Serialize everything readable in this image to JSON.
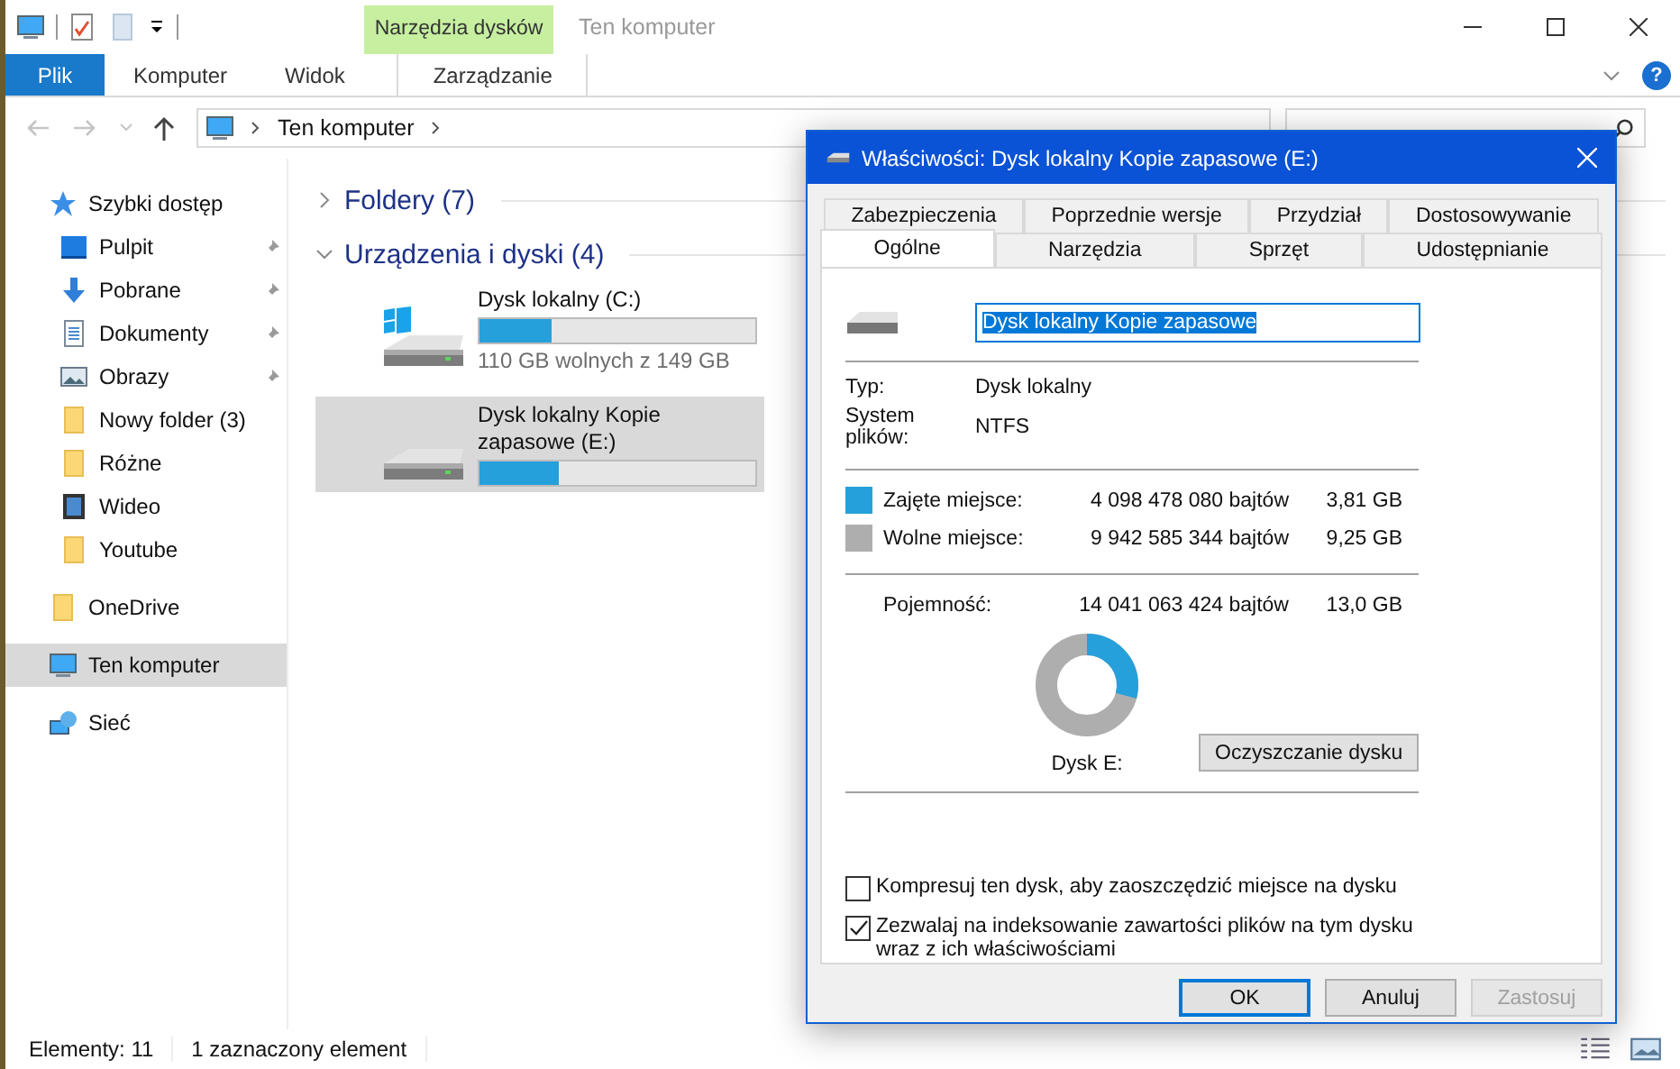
{
  "ribbon": {
    "context_group": "Narzędzia dysków",
    "window_title": "Ten komputer",
    "help": "?",
    "tabs": [
      {
        "label": "Plik",
        "kind": "file"
      },
      {
        "label": "Komputer",
        "kind": "normal"
      },
      {
        "label": "Widok",
        "kind": "normal"
      },
      {
        "label": "Zarządzanie",
        "kind": "context"
      }
    ]
  },
  "address": {
    "path": [
      "Ten komputer"
    ]
  },
  "sidebar": {
    "items": [
      {
        "label": "Szybki dostęp",
        "kind": "star",
        "selected": false,
        "children": [
          {
            "label": "Pulpit",
            "kind": "desktop",
            "pinned": true,
            "selected": false
          },
          {
            "label": "Pobrane",
            "kind": "download",
            "pinned": true,
            "selected": false
          },
          {
            "label": "Dokumenty",
            "kind": "documents",
            "pinned": true,
            "selected": false
          },
          {
            "label": "Obrazy",
            "kind": "pictures",
            "pinned": true,
            "selected": false
          },
          {
            "label": "Nowy folder (3)",
            "kind": "folder",
            "pinned": false,
            "selected": false
          },
          {
            "label": "Różne",
            "kind": "folder",
            "pinned": false,
            "selected": false
          },
          {
            "label": "Wideo",
            "kind": "video",
            "pinned": false,
            "selected": false
          },
          {
            "label": "Youtube",
            "kind": "folder",
            "pinned": false,
            "selected": false
          }
        ]
      },
      {
        "label": "OneDrive",
        "kind": "folder",
        "selected": false
      },
      {
        "label": "Ten komputer",
        "kind": "computer",
        "selected": true
      },
      {
        "label": "Sieć",
        "kind": "network",
        "selected": false
      }
    ]
  },
  "groups": [
    {
      "label": "Foldery (7)",
      "expanded": false
    },
    {
      "label": "Urządzenia i dyski (4)",
      "expanded": true,
      "drives": [
        {
          "name": "Dysk lokalny (C:)",
          "free": "110 GB wolnych z 149 GB",
          "level": 0.26,
          "system": true,
          "selected": false
        },
        {
          "name": "Dysk lokalny Kopie zapasowe (E:)",
          "level": 0.29,
          "system": false,
          "selected": true
        }
      ]
    }
  ],
  "status_bar": {
    "items": "Elementy: 11",
    "selection": "1 zaznaczony element"
  },
  "dialog": {
    "title": "Właściwości: Dysk lokalny Kopie zapasowe (E:)",
    "tab_rows": [
      [
        {
          "label": "Zabezpieczenia",
          "selected": false
        },
        {
          "label": "Poprzednie wersje",
          "selected": false
        },
        {
          "label": "Przydział",
          "selected": false
        },
        {
          "label": "Dostosowywanie",
          "selected": false
        }
      ],
      [
        {
          "label": "Ogólne",
          "selected": true
        },
        {
          "label": "Narzędzia",
          "selected": false
        },
        {
          "label": "Sprzęt",
          "selected": false
        },
        {
          "label": "Udostępnianie",
          "selected": false
        }
      ]
    ],
    "name_field": {
      "value": "Dysk lokalny Kopie zapasowe"
    },
    "info": [
      {
        "label": "Typ:",
        "value": "Dysk lokalny"
      },
      {
        "label": "System plików:",
        "value": "NTFS"
      }
    ],
    "usage": [
      {
        "label": "Zajęte miejsce:",
        "bytes": "4 098 478 080 bajtów",
        "size": "3,81 GB",
        "color": "#26a0da"
      },
      {
        "label": "Wolne miejsce:",
        "bytes": "9 942 585 344 bajtów",
        "size": "9,25 GB",
        "color": "#aeaeae"
      }
    ],
    "capacity": {
      "label": "Pojemność:",
      "bytes": "14 041 063 424 bajtów",
      "size": "13,0 GB"
    },
    "usage_chart": {
      "level": 0.292
    },
    "drive_label": "Dysk E:",
    "cleanup_button": "Oczyszczanie dysku",
    "options": [
      {
        "label": "Kompresuj ten dysk, aby zaoszczędzić miejsce na dysku",
        "checked": false
      },
      {
        "label": "Zezwalaj na indeksowanie zawartości plików na tym dysku wraz z ich właściwościami",
        "checked": true
      }
    ],
    "buttons": [
      {
        "label": "OK",
        "default": true,
        "disabled": false
      },
      {
        "label": "Anuluj",
        "default": false,
        "disabled": false
      },
      {
        "label": "Zastosuj",
        "default": false,
        "disabled": true
      }
    ]
  }
}
